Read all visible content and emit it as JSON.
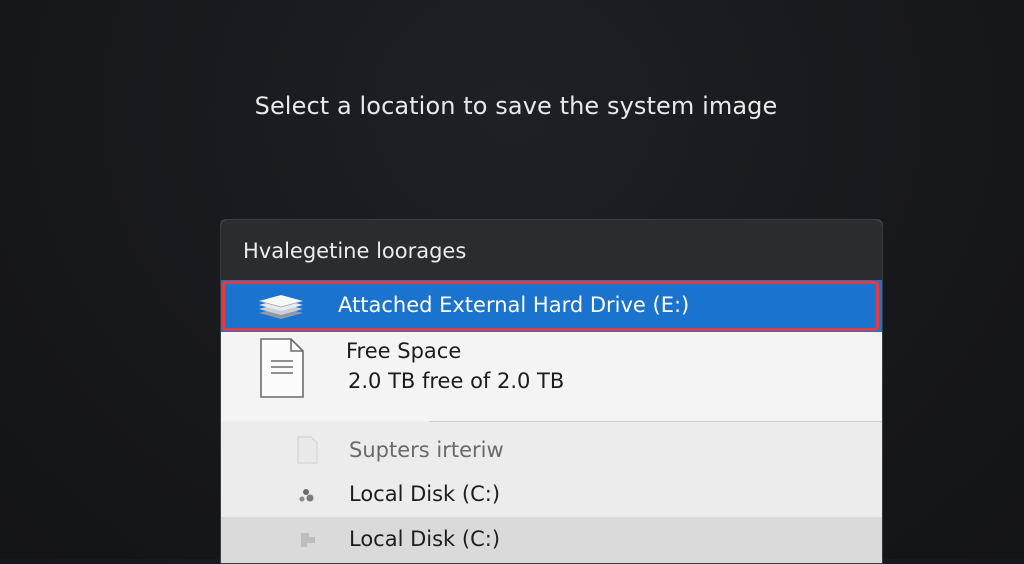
{
  "page": {
    "title": "Select a location to save the system image"
  },
  "panel": {
    "header_label": "Hvalegetine loorages",
    "selected_item": {
      "label": "Attached External Hard Drive (E:)",
      "icon": "drive-stack-icon"
    },
    "details": {
      "icon": "document-icon",
      "free_space_label": "Free Space",
      "free_space_value": "2.0 TB free of 2.0 TB"
    },
    "items": [
      {
        "label": "Supters irteriw",
        "icon": "file-icon"
      },
      {
        "label": "Local Disk (C:)",
        "icon": "disk-icon"
      },
      {
        "label": "Local Disk (C:)",
        "icon": "disk-icon"
      }
    ]
  },
  "colors": {
    "background": "#17181c",
    "selection": "#1a74cf",
    "selection_outline": "#e13b43",
    "panel_header": "#2b2c30"
  }
}
